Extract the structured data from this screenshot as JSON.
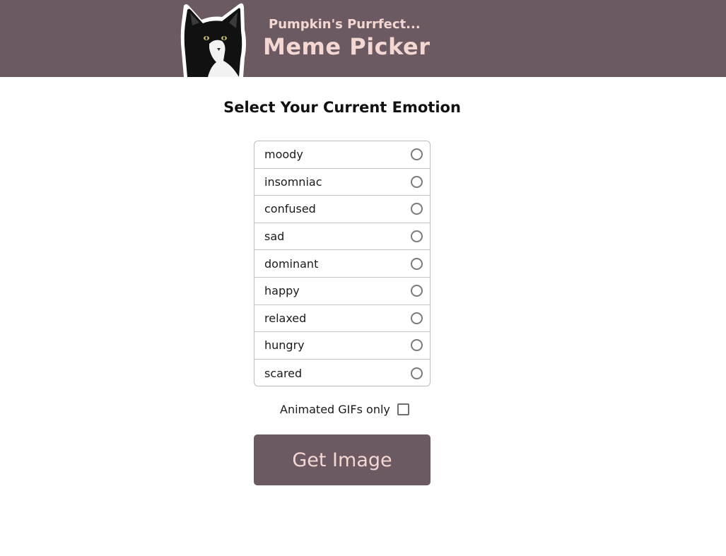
{
  "header": {
    "subtitle": "Pumpkin's Purrfect...",
    "title": "Meme Picker",
    "logo_icon": "tuxedo-cat-logo",
    "background_color": "#6b5a61",
    "text_color": "#f4d7d2"
  },
  "main": {
    "heading": "Select Your Current Emotion",
    "emotions": [
      {
        "label": "moody"
      },
      {
        "label": "insomniac"
      },
      {
        "label": "confused"
      },
      {
        "label": "sad"
      },
      {
        "label": "dominant"
      },
      {
        "label": "happy"
      },
      {
        "label": "relaxed"
      },
      {
        "label": "hungry"
      },
      {
        "label": "scared"
      }
    ],
    "gifs_only_label": "Animated GIFs only",
    "gifs_only_checked": false,
    "get_image_label": "Get Image",
    "button_color": "#6b5a61"
  }
}
